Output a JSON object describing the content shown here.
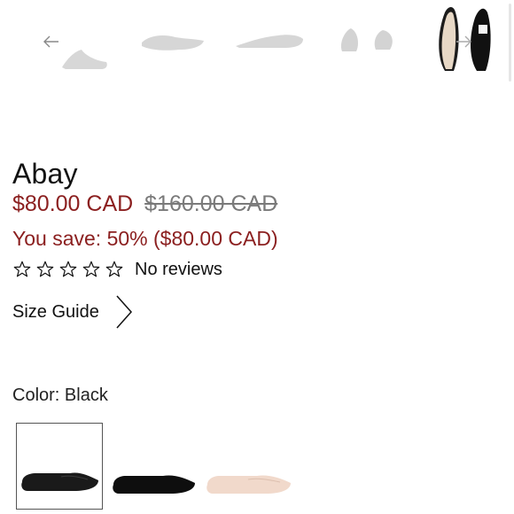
{
  "gallery": {
    "prev_icon": "arrow-left-icon",
    "next_icon": "arrow-right-icon",
    "thumbnails": [
      "shoe-side-view",
      "shoe-top-view",
      "shoe-profile-view",
      "shoe-front-pair-view",
      "shoe-top-sole-view"
    ]
  },
  "product": {
    "title": "Abay",
    "price_sale": "$80.00 CAD",
    "price_original": "$160.00 CAD",
    "savings": "You save: 50% ($80.00 CAD)",
    "rating": {
      "stars": 0,
      "max": 5,
      "text": "No reviews"
    },
    "size_guide_label": "Size Guide",
    "color_label": "Color: Black",
    "swatches": [
      {
        "name": "black-leather",
        "color": "#1a1a1a",
        "selected": true
      },
      {
        "name": "black-suede",
        "color": "#0e0e0e",
        "selected": false
      },
      {
        "name": "blush",
        "color": "#f1d9cb",
        "selected": false
      }
    ]
  },
  "colors": {
    "sale": "#8b1f1f",
    "original_price": "#7a7a7a"
  }
}
